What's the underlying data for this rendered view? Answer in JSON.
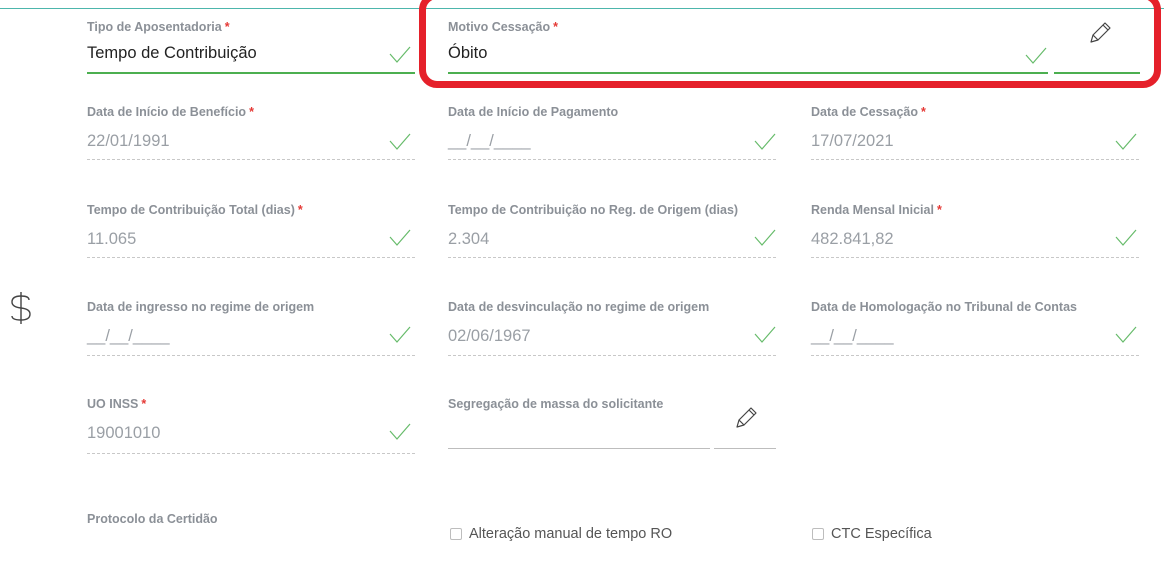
{
  "fields": {
    "tipo_aposentadoria": {
      "label": "Tipo de Aposentadoria",
      "required": "*",
      "value": "Tempo de Contribuição"
    },
    "motivo_cessacao": {
      "label": "Motivo Cessação",
      "required": "*",
      "value": "Óbito"
    },
    "data_inicio_beneficio": {
      "label": "Data de Início de Benefício",
      "required": "*",
      "value": "22/01/1991"
    },
    "data_inicio_pagamento": {
      "label": "Data de Início de Pagamento",
      "value": "__/__/____"
    },
    "data_cessacao": {
      "label": "Data de Cessação",
      "required": "*",
      "value": "17/07/2021"
    },
    "tempo_contribuicao_total": {
      "label": "Tempo de Contribuição Total (dias)",
      "required": "*",
      "value": "11.065"
    },
    "tempo_contribuicao_reg_origem": {
      "label": "Tempo de Contribuição no Reg. de Origem (dias)",
      "value": "2.304"
    },
    "renda_mensal_inicial": {
      "label": "Renda Mensal Inicial",
      "required": "*",
      "value": "482.841,82"
    },
    "data_ingresso_regime": {
      "label": "Data de ingresso no regime de origem",
      "value": "__/__/____"
    },
    "data_desvinculacao_regime": {
      "label": "Data de desvinculação no regime de origem",
      "value": "02/06/1967"
    },
    "data_homologacao": {
      "label": "Data de Homologação no Tribunal de Contas",
      "value": "__/__/____"
    },
    "uo_inss": {
      "label": "UO INSS",
      "required": "*",
      "value": "19001010"
    },
    "segregacao_massa": {
      "label": "Segregação de massa do solicitante",
      "value": ""
    },
    "protocolo_certidao": {
      "label": "Protocolo da Certidão"
    }
  },
  "checkboxes": {
    "alteracao_manual": {
      "label": "Alteração manual de tempo RO"
    },
    "ctc_especifica": {
      "label": "CTC Específica"
    }
  },
  "icons": {
    "check": "check-icon",
    "pencil": "pencil-icon",
    "currency": "dollar-icon"
  },
  "colors": {
    "accent_green": "#4caf50",
    "required_red": "#e53935",
    "highlight_red": "#e5202a",
    "top_line": "#4db6ac"
  }
}
